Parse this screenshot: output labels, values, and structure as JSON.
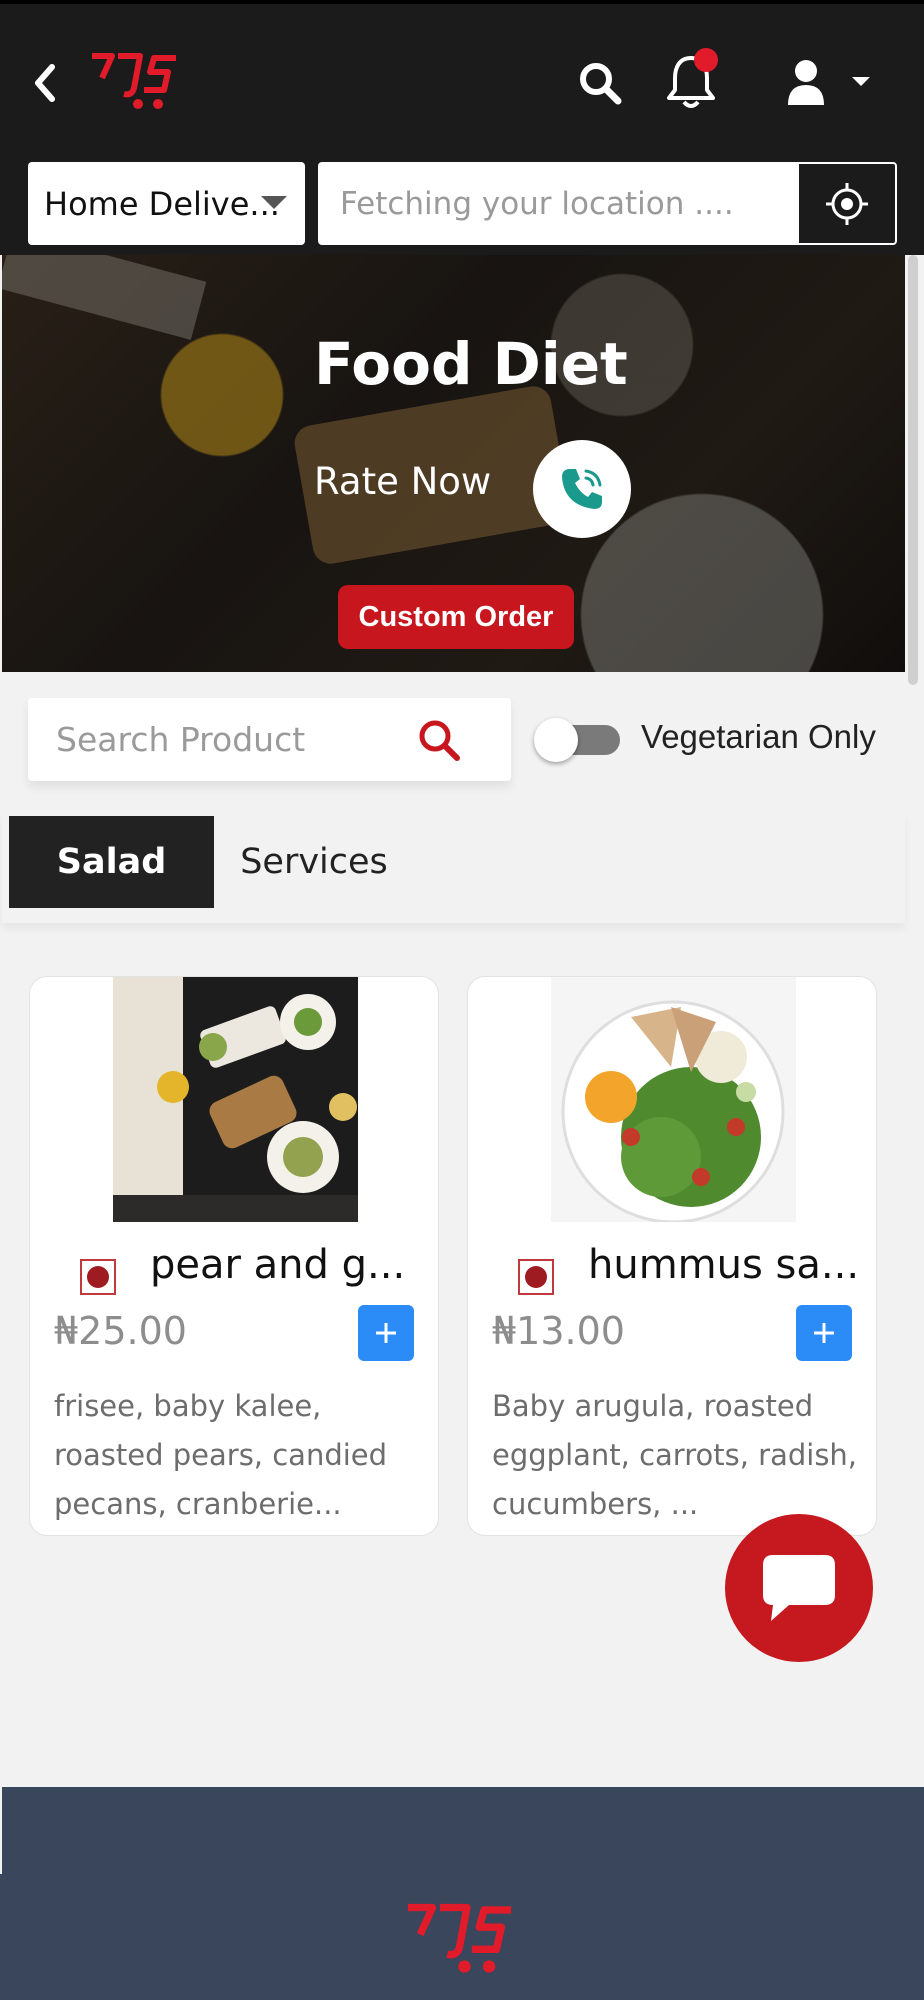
{
  "header": {
    "delivery_mode": "Home Delive...",
    "location_placeholder": "Fetching your location ....",
    "notification_badge_color": "#e21b2a",
    "brand_color": "#e21b2a"
  },
  "hero": {
    "title": "Food Diet",
    "rate_label": "Rate Now",
    "custom_order_label": "Custom Order"
  },
  "search": {
    "placeholder": "Search Product",
    "veg_label": "Vegetarian Only",
    "veg_enabled": false
  },
  "tabs": [
    {
      "label": "Salad",
      "active": true
    },
    {
      "label": "Services",
      "active": false
    }
  ],
  "products": [
    {
      "name": "pear and g...",
      "price": "₦25.00",
      "description": "frisee, baby kalee, roasted pears, candied pecans, cranberie...",
      "veg_mark": "veg-indicator-icon"
    },
    {
      "name": "hummus sa...",
      "price": "₦13.00",
      "description": "Baby arugula, roasted eggplant, carrots, radish, cucumbers, ...",
      "veg_mark": "veg-indicator-icon"
    }
  ],
  "colors": {
    "topbar": "#1b1b1b",
    "accent_red": "#c8161e",
    "add_button": "#2b8bf7",
    "footer": "#3a465b"
  }
}
